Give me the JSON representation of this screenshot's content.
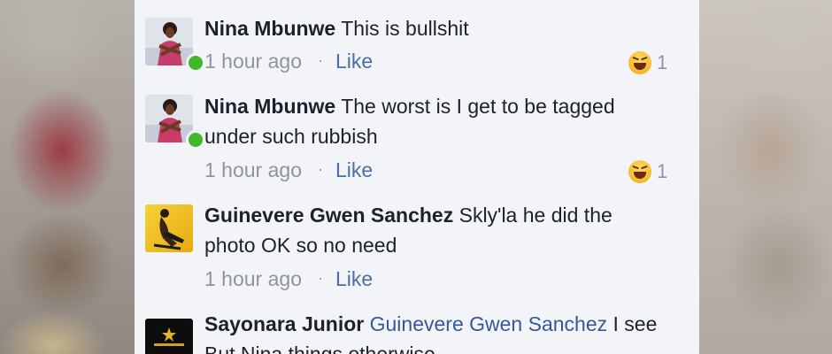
{
  "comments": [
    {
      "author": "Nina Mbunwe",
      "text": "This is bullshit",
      "time": "1 hour ago",
      "separator": "·",
      "like_label": "Like",
      "reaction_count": "1",
      "reaction_icon": "laughing-emoji-icon",
      "online": true
    },
    {
      "author": "Nina Mbunwe",
      "text": "The worst is I get to be tagged under such rubbish",
      "time": "1 hour ago",
      "separator": "·",
      "like_label": "Like",
      "reaction_count": "1",
      "reaction_icon": "laughing-emoji-icon",
      "online": true
    },
    {
      "author": "Guinevere Gwen Sanchez",
      "text": "Skly'la he did the photo OK so no need",
      "time": "1 hour ago",
      "separator": "·",
      "like_label": "Like"
    },
    {
      "author": "Sayonara Junior",
      "mention": "Guinevere Gwen Sanchez",
      "text": "I see But Nina things otherwise"
    }
  ],
  "colors": {
    "panel_bg": "#f3f4f7",
    "text": "#1d2129",
    "meta": "#90949c",
    "link": "#365899",
    "online": "#42b72a"
  }
}
